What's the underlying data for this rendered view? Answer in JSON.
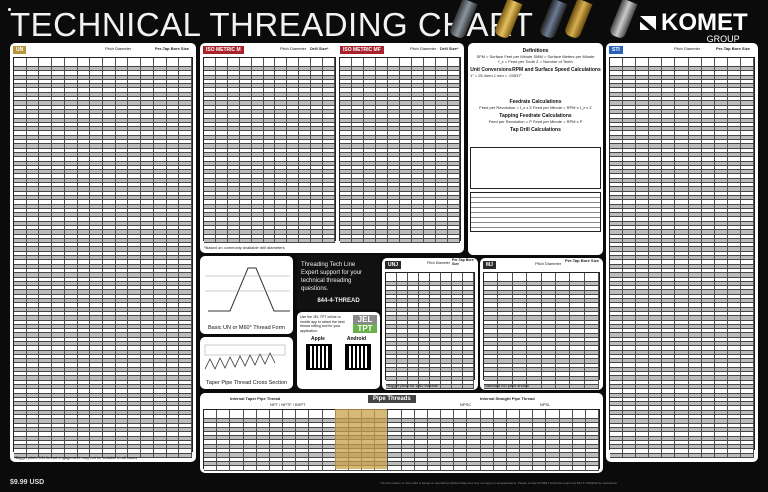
{
  "header": {
    "title": "TECHNICAL THREADING CHART",
    "brand": "KOMET",
    "brand_sub": "GROUP"
  },
  "colors": {
    "un": "#b8963e",
    "metric": "#a8232b",
    "blue": "#2a62b8",
    "pipe_gold": "#c9a24a",
    "dark": "#2b2b2b"
  },
  "un": {
    "label": "UN",
    "pitch_diameter": "Pitch Diameter",
    "tap_drill": "Per-Tap Bore Size"
  },
  "metric_m": {
    "label": "ISO METRIC M",
    "pitch_diameter": "Pitch Diameter",
    "drill": "Drill Size*"
  },
  "metric_mf": {
    "label": "ISO METRIC MF",
    "pitch_diameter": "Pitch Diameter",
    "drill": "Drill Size*"
  },
  "metric_note": "*Based on commonly available drill diameters",
  "right": {
    "label": "STI",
    "pitch_diameter": "Pitch Diameter",
    "tap_drill": "Per-Tap Bore Size"
  },
  "definitions": {
    "title": "Definitions",
    "lines": [
      "SFM = Surface Feet per Minute   SMM = Surface Meters per Minute",
      "f_z = Feed per Tooth   Z = Number of Teeth"
    ],
    "unit_conv": "Unit Conversions",
    "unit_line": "1\" = 25.4mm   1 mm = .03937\"",
    "rpm": "RPM and Surface Speed Calculations",
    "feed": "Feedrate Calculations",
    "feed_line": "Feed per Revolution = f_z x Z    Feed per Minute = RPM x f_z x Z",
    "tap_feed": "Tapping Feedrate Calculations",
    "tap_feed_line": "Feed per Revolution = P    Feed per Minute = RPM x P",
    "tap_drill": "Tap Drill Calculations"
  },
  "diagrams": {
    "thread_form": "Basic UN or M60° Thread Form",
    "taper": "Taper Pipe Thread Cross Section"
  },
  "techline": {
    "title": "Threading Tech Line",
    "text": "Expert support for your technical threading questions.",
    "phone": "844-4-THREAD"
  },
  "app": {
    "badge_top": "JEL",
    "badge_bottom": "TPT",
    "apple": "Apple",
    "android": "Android",
    "text": "Use the JEL TPT online or mobile app to select the best thread milling tool for your application."
  },
  "unj": {
    "label": "UNJ",
    "pitch_diameter": "Pitch Diameter",
    "tap_drill": "Per-Tap Bore Size",
    "note": "*Bigger pitch for UNJ threads"
  },
  "mj": {
    "label": "MJ",
    "pitch_diameter": "Pitch Diameter",
    "tap_drill": "Per-Tap Bore Size",
    "note": "Standard MJ pitch shown"
  },
  "pipe": {
    "title": "Pipe Threads",
    "taper": "Internal Taper Pipe Thread",
    "taper_types": "NPT / NPTF / BSPT",
    "straight": "Internal Straight Pipe Thread",
    "s1": "NPSC",
    "s2": "NPSL"
  },
  "footer": {
    "price": "$9.99 USD",
    "fine": "The information on this chart is based on standard published data and may not apply to all applications. Please contact KOMET technical support at 844-4-THREAD for assistance.",
    "un_note": "*Bigger pitch: UN thread engagement may not be suitable in all cases"
  }
}
